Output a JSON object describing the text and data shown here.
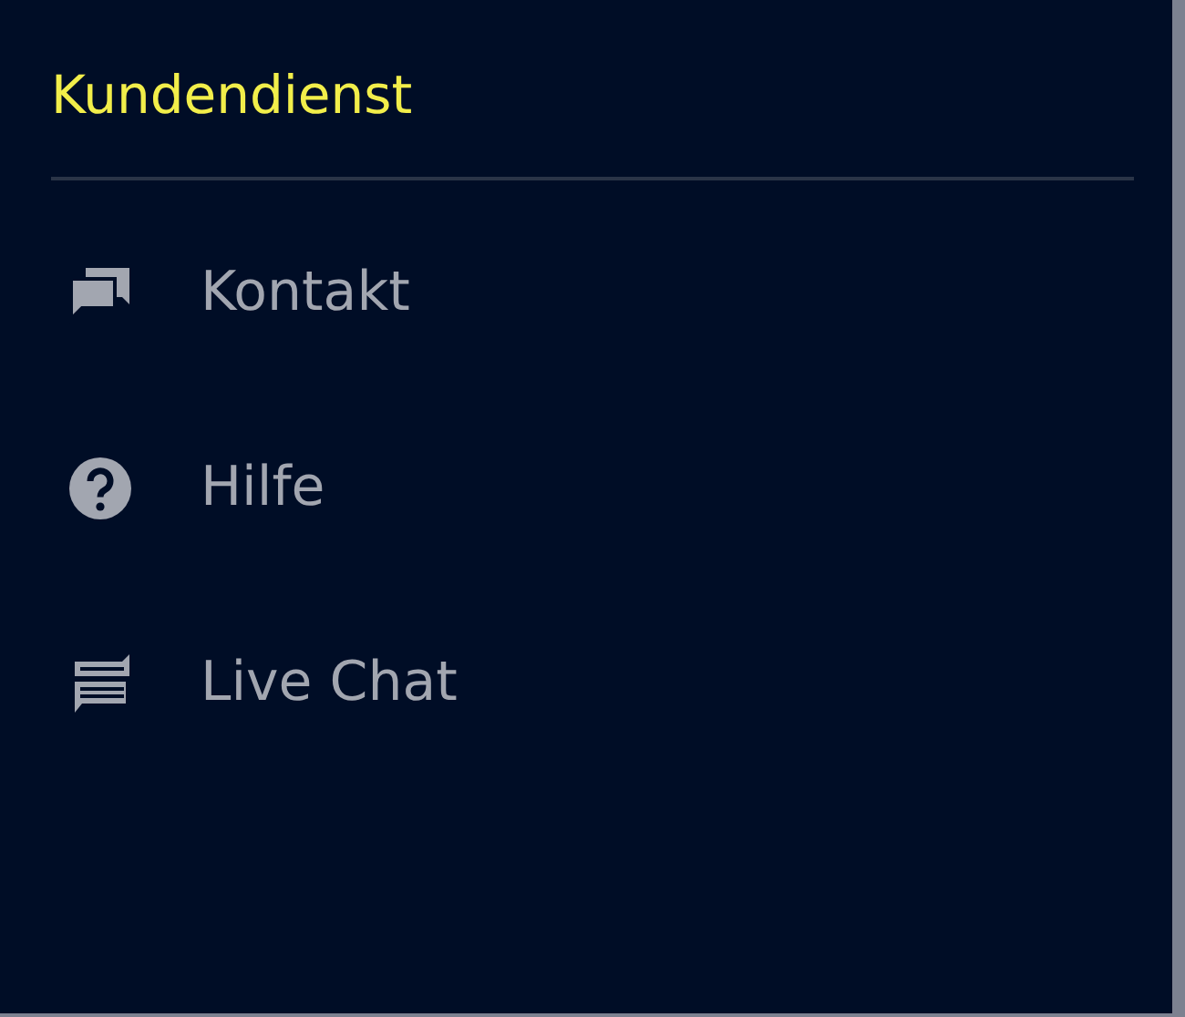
{
  "panel": {
    "title": "Kundendienst",
    "items": [
      {
        "kind": "contact",
        "label": "Kontakt"
      },
      {
        "kind": "help",
        "label": "Hilfe"
      },
      {
        "kind": "chat",
        "label": "Live Chat"
      }
    ]
  }
}
